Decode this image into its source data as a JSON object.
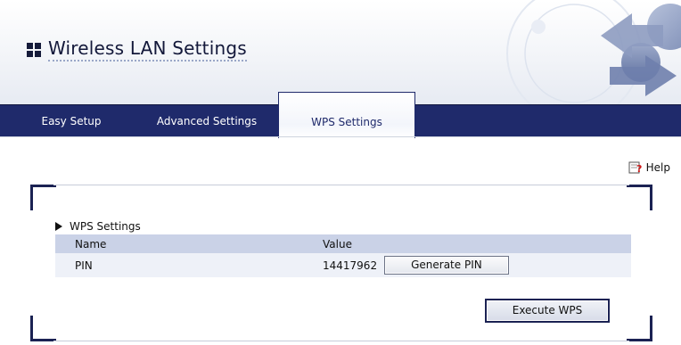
{
  "header": {
    "title": "Wireless LAN Settings"
  },
  "nav": {
    "tabs": [
      {
        "label": "Easy Setup",
        "active": false
      },
      {
        "label": "Advanced Settings",
        "active": false
      },
      {
        "label": "WPS Settings",
        "active": true
      }
    ]
  },
  "help": {
    "label": "Help",
    "icon": "help-book-icon"
  },
  "section": {
    "title": "WPS Settings",
    "table": {
      "columns": [
        "Name",
        "Value"
      ],
      "rows": [
        {
          "name": "PIN",
          "value": "14417962",
          "button_label": "Generate PIN"
        }
      ]
    },
    "execute_label": "Execute WPS"
  },
  "colors": {
    "navbar": "#1f2a6b",
    "table_header": "#cad2e7",
    "table_row": "#eef1f8",
    "frame": "#1b2253"
  }
}
